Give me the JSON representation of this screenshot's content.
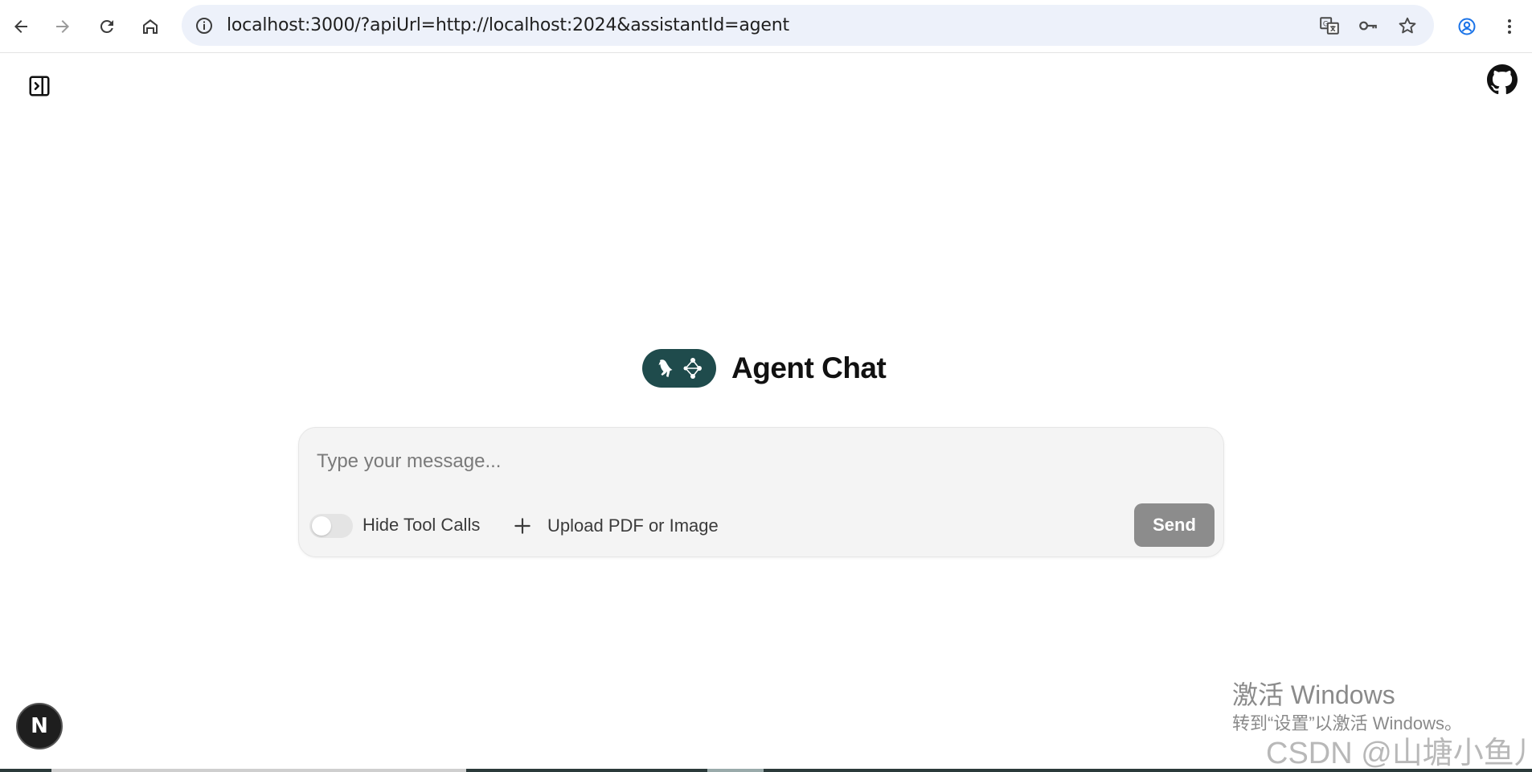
{
  "browser": {
    "url": "localhost:3000/?apiUrl=http://localhost:2024&assistantId=agent",
    "icons": {
      "back": "arrow-left-icon",
      "forward": "arrow-right-icon",
      "reload": "reload-icon",
      "home": "home-icon",
      "site_info": "info-icon",
      "translate": "translate-icon",
      "passwords": "key-icon",
      "bookmark": "star-icon",
      "profile": "profile-icon",
      "menu": "kebab-menu-icon"
    }
  },
  "app": {
    "title": "Agent Chat",
    "logo_color": "#1f4b4c",
    "composer": {
      "placeholder": "Type your message...",
      "value": "",
      "hide_tool_calls_label": "Hide Tool Calls",
      "hide_tool_calls_on": false,
      "upload_label": "Upload PDF or Image",
      "send_label": "Send",
      "send_color": "#8c8c8c"
    },
    "dev_badge": "N"
  },
  "watermarks": {
    "windows_title": "激活 Windows",
    "windows_sub": "转到“设置”以激活 Windows。",
    "csdn": "CSDN @山塘小鱼儿"
  }
}
